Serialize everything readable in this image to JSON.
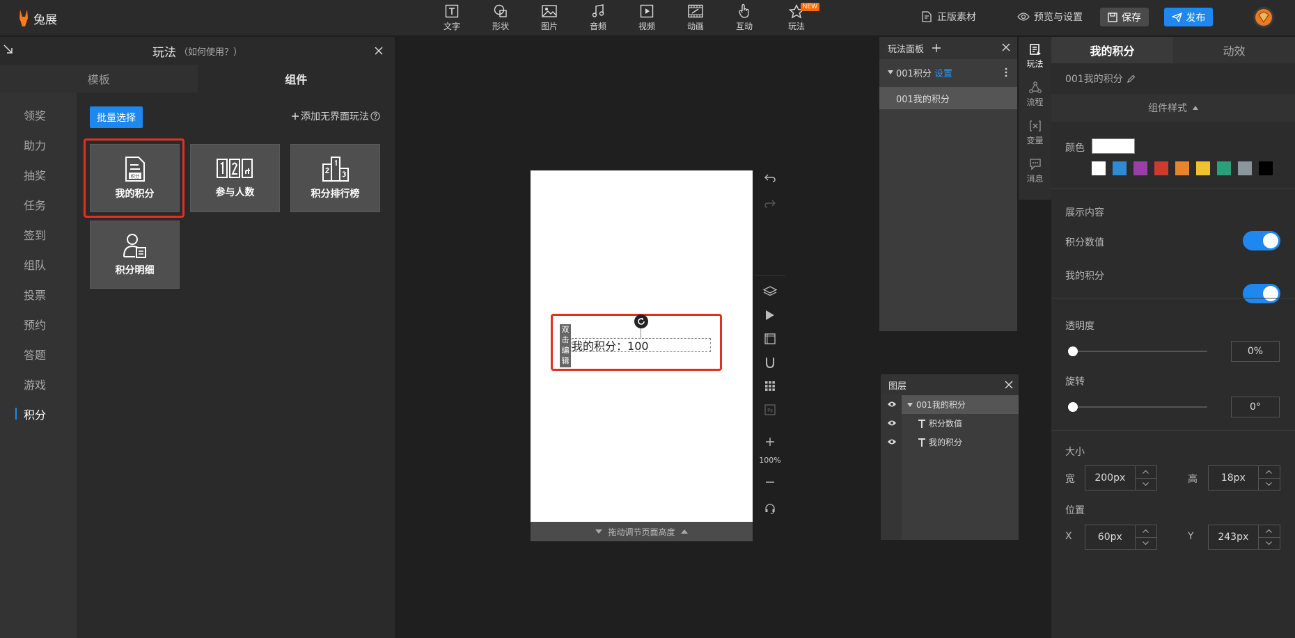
{
  "app": {
    "logo_text": "兔展"
  },
  "toolbar": {
    "tools": [
      {
        "label": "文字",
        "icon": "text-icon"
      },
      {
        "label": "形状",
        "icon": "shape-icon"
      },
      {
        "label": "图片",
        "icon": "image-icon"
      },
      {
        "label": "音频",
        "icon": "music-icon"
      },
      {
        "label": "视频",
        "icon": "video-icon"
      },
      {
        "label": "动画",
        "icon": "animation-icon"
      },
      {
        "label": "互动",
        "icon": "hand-icon"
      },
      {
        "label": "玩法",
        "icon": "star-icon",
        "badge": "NEW"
      }
    ],
    "licensed_assets": "正版素材",
    "preview_settings": "预览与设置",
    "save": "保存",
    "publish": "发布"
  },
  "left_panel": {
    "title": "玩法",
    "howto": "（如何使用？）",
    "tabs": [
      "模板",
      "组件"
    ],
    "active_tab": "组件",
    "categories": [
      "领奖",
      "助力",
      "抽奖",
      "任务",
      "签到",
      "组队",
      "投票",
      "预约",
      "答题",
      "游戏",
      "积分"
    ],
    "active_category": "积分",
    "batch_select": "批量选择",
    "add_no_interface": "添加无界面玩法",
    "components": [
      "我的积分",
      "参与人数",
      "积分排行榜",
      "积分明细"
    ],
    "selected_component": "我的积分",
    "card_icon_text": "积分"
  },
  "canvas": {
    "double_click_edit": [
      "双",
      "击",
      "编",
      "辑"
    ],
    "score_label": "我的积分：",
    "score_value": "100",
    "drag_hint": "拖动调节页面高度",
    "zoom": "100%"
  },
  "play_panel": {
    "title": "玩法面板",
    "group": "001积分",
    "group_setting": "设置",
    "item": "001我的积分"
  },
  "layers": {
    "title": "图层",
    "group": "001我的积分",
    "items": [
      "积分数值",
      "我的积分"
    ]
  },
  "side_tabs": [
    "玩法",
    "流程",
    "变量",
    "消息"
  ],
  "props": {
    "tabs": [
      "我的积分",
      "动效"
    ],
    "component_name": "001我的积分",
    "section": "组件样式",
    "color_label": "颜色",
    "colors": [
      "#ffffff",
      "#2f8ad4",
      "#9a3fa9",
      "#d0392b",
      "#e8852a",
      "#f0c230",
      "#2aa07a",
      "#8a969e",
      "#000000"
    ],
    "display_content": "展示内容",
    "toggles": [
      {
        "label": "积分数值",
        "on": true
      },
      {
        "label": "我的积分",
        "on": true
      }
    ],
    "opacity_label": "透明度",
    "opacity_value": "0%",
    "rotate_label": "旋转",
    "rotate_value": "0°",
    "size_label": "大小",
    "width_label": "宽",
    "width_value": "200px",
    "height_label": "高",
    "height_value": "18px",
    "position_label": "位置",
    "x_label": "X",
    "x_value": "60px",
    "y_label": "Y",
    "y_value": "243px"
  }
}
